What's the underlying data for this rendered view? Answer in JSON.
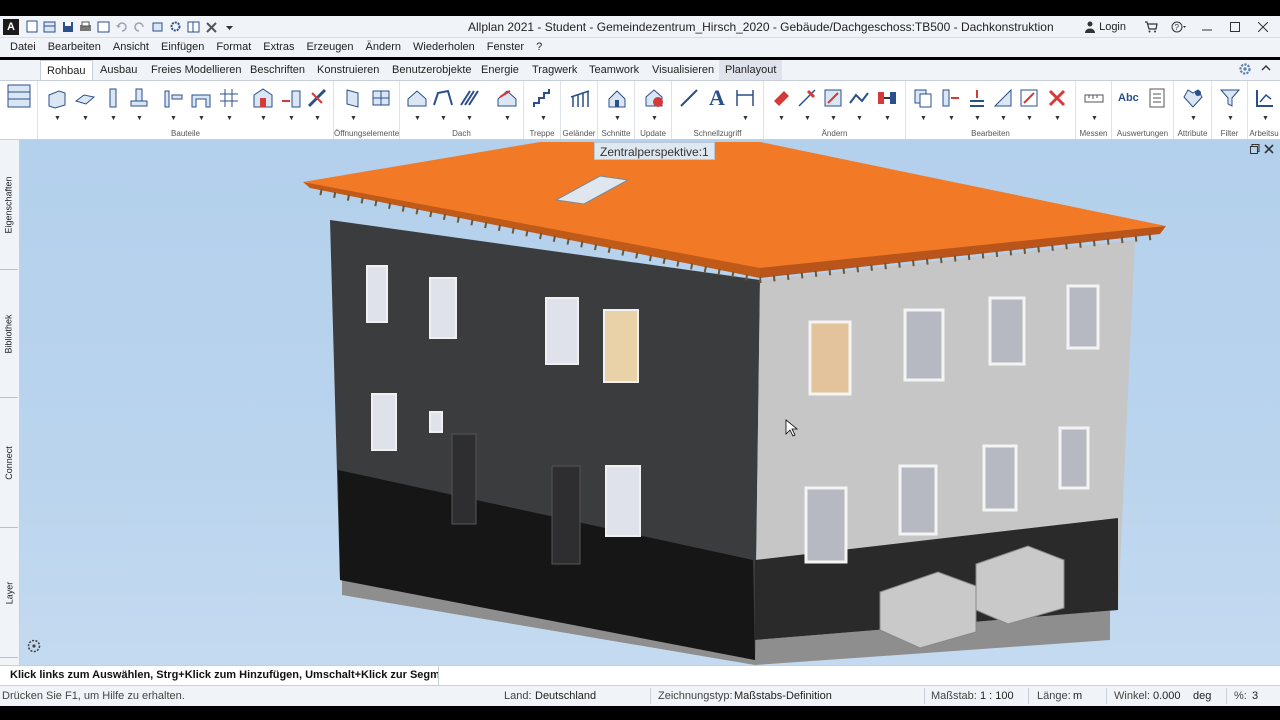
{
  "window": {
    "app_letter": "A",
    "title": "Allplan 2021 - Student - Gemeindezentrum_Hirsch_2020 - Gebäude/Dachgeschoss:TB500 - Dachkonstruktion",
    "login_label": "Login"
  },
  "menu": [
    "Datei",
    "Bearbeiten",
    "Ansicht",
    "Einfügen",
    "Format",
    "Extras",
    "Erzeugen",
    "Ändern",
    "Wiederholen",
    "Fenster",
    "?"
  ],
  "ribbon_tabs": [
    "Rohbau",
    "Ausbau",
    "Freies Modellieren",
    "Beschriften",
    "Konstruieren",
    "Benutzerobjekte",
    "Energie",
    "Tragwerk",
    "Teamwork",
    "Visualisieren",
    "Planlayout"
  ],
  "active_tab": "Rohbau",
  "ribbon_groups": [
    "Bauteile",
    "Öffnungselemente",
    "Dach",
    "Treppe",
    "Geländer",
    "Schnitte",
    "Update",
    "Schnellzugriff",
    "Ändern",
    "Bearbeiten",
    "Messen",
    "Auswertungen",
    "Attribute",
    "Filter",
    "Arbeitsu"
  ],
  "ribbon_text_icons": {
    "text_tool": "A",
    "spelling": "Abc"
  },
  "side_tabs": [
    "Eigenschaften",
    "Bibliothek",
    "Connect",
    "Layer"
  ],
  "viewport": {
    "label": "Zentralperspektive:1",
    "colors": {
      "background": "#b8d2ed",
      "roof": "#f27a26",
      "wall_dark": "#3b3c3e",
      "wall_light": "#c4c4c4",
      "plinth": "#141414"
    }
  },
  "prompt": {
    "text": "Klick links zum Auswählen, Strg+Klick zum Hinzufügen, Umschalt+Klick zur Segmentwahl"
  },
  "status": {
    "help": "Drücken Sie F1, um Hilfe zu erhalten.",
    "land_label": "Land:",
    "land_value": "Deutschland",
    "zeichnungstyp_label": "Zeichnungstyp:",
    "zeichnungstyp_value": "Maßstabs-Definition",
    "massstab_label": "Maßstab:",
    "massstab_value": "1 : 100",
    "laenge_label": "Länge:",
    "laenge_value": "m",
    "winkel_label": "Winkel:",
    "winkel_value": "0.000",
    "winkel_unit": "deg",
    "percent_label": "%:",
    "percent_value": "3"
  }
}
